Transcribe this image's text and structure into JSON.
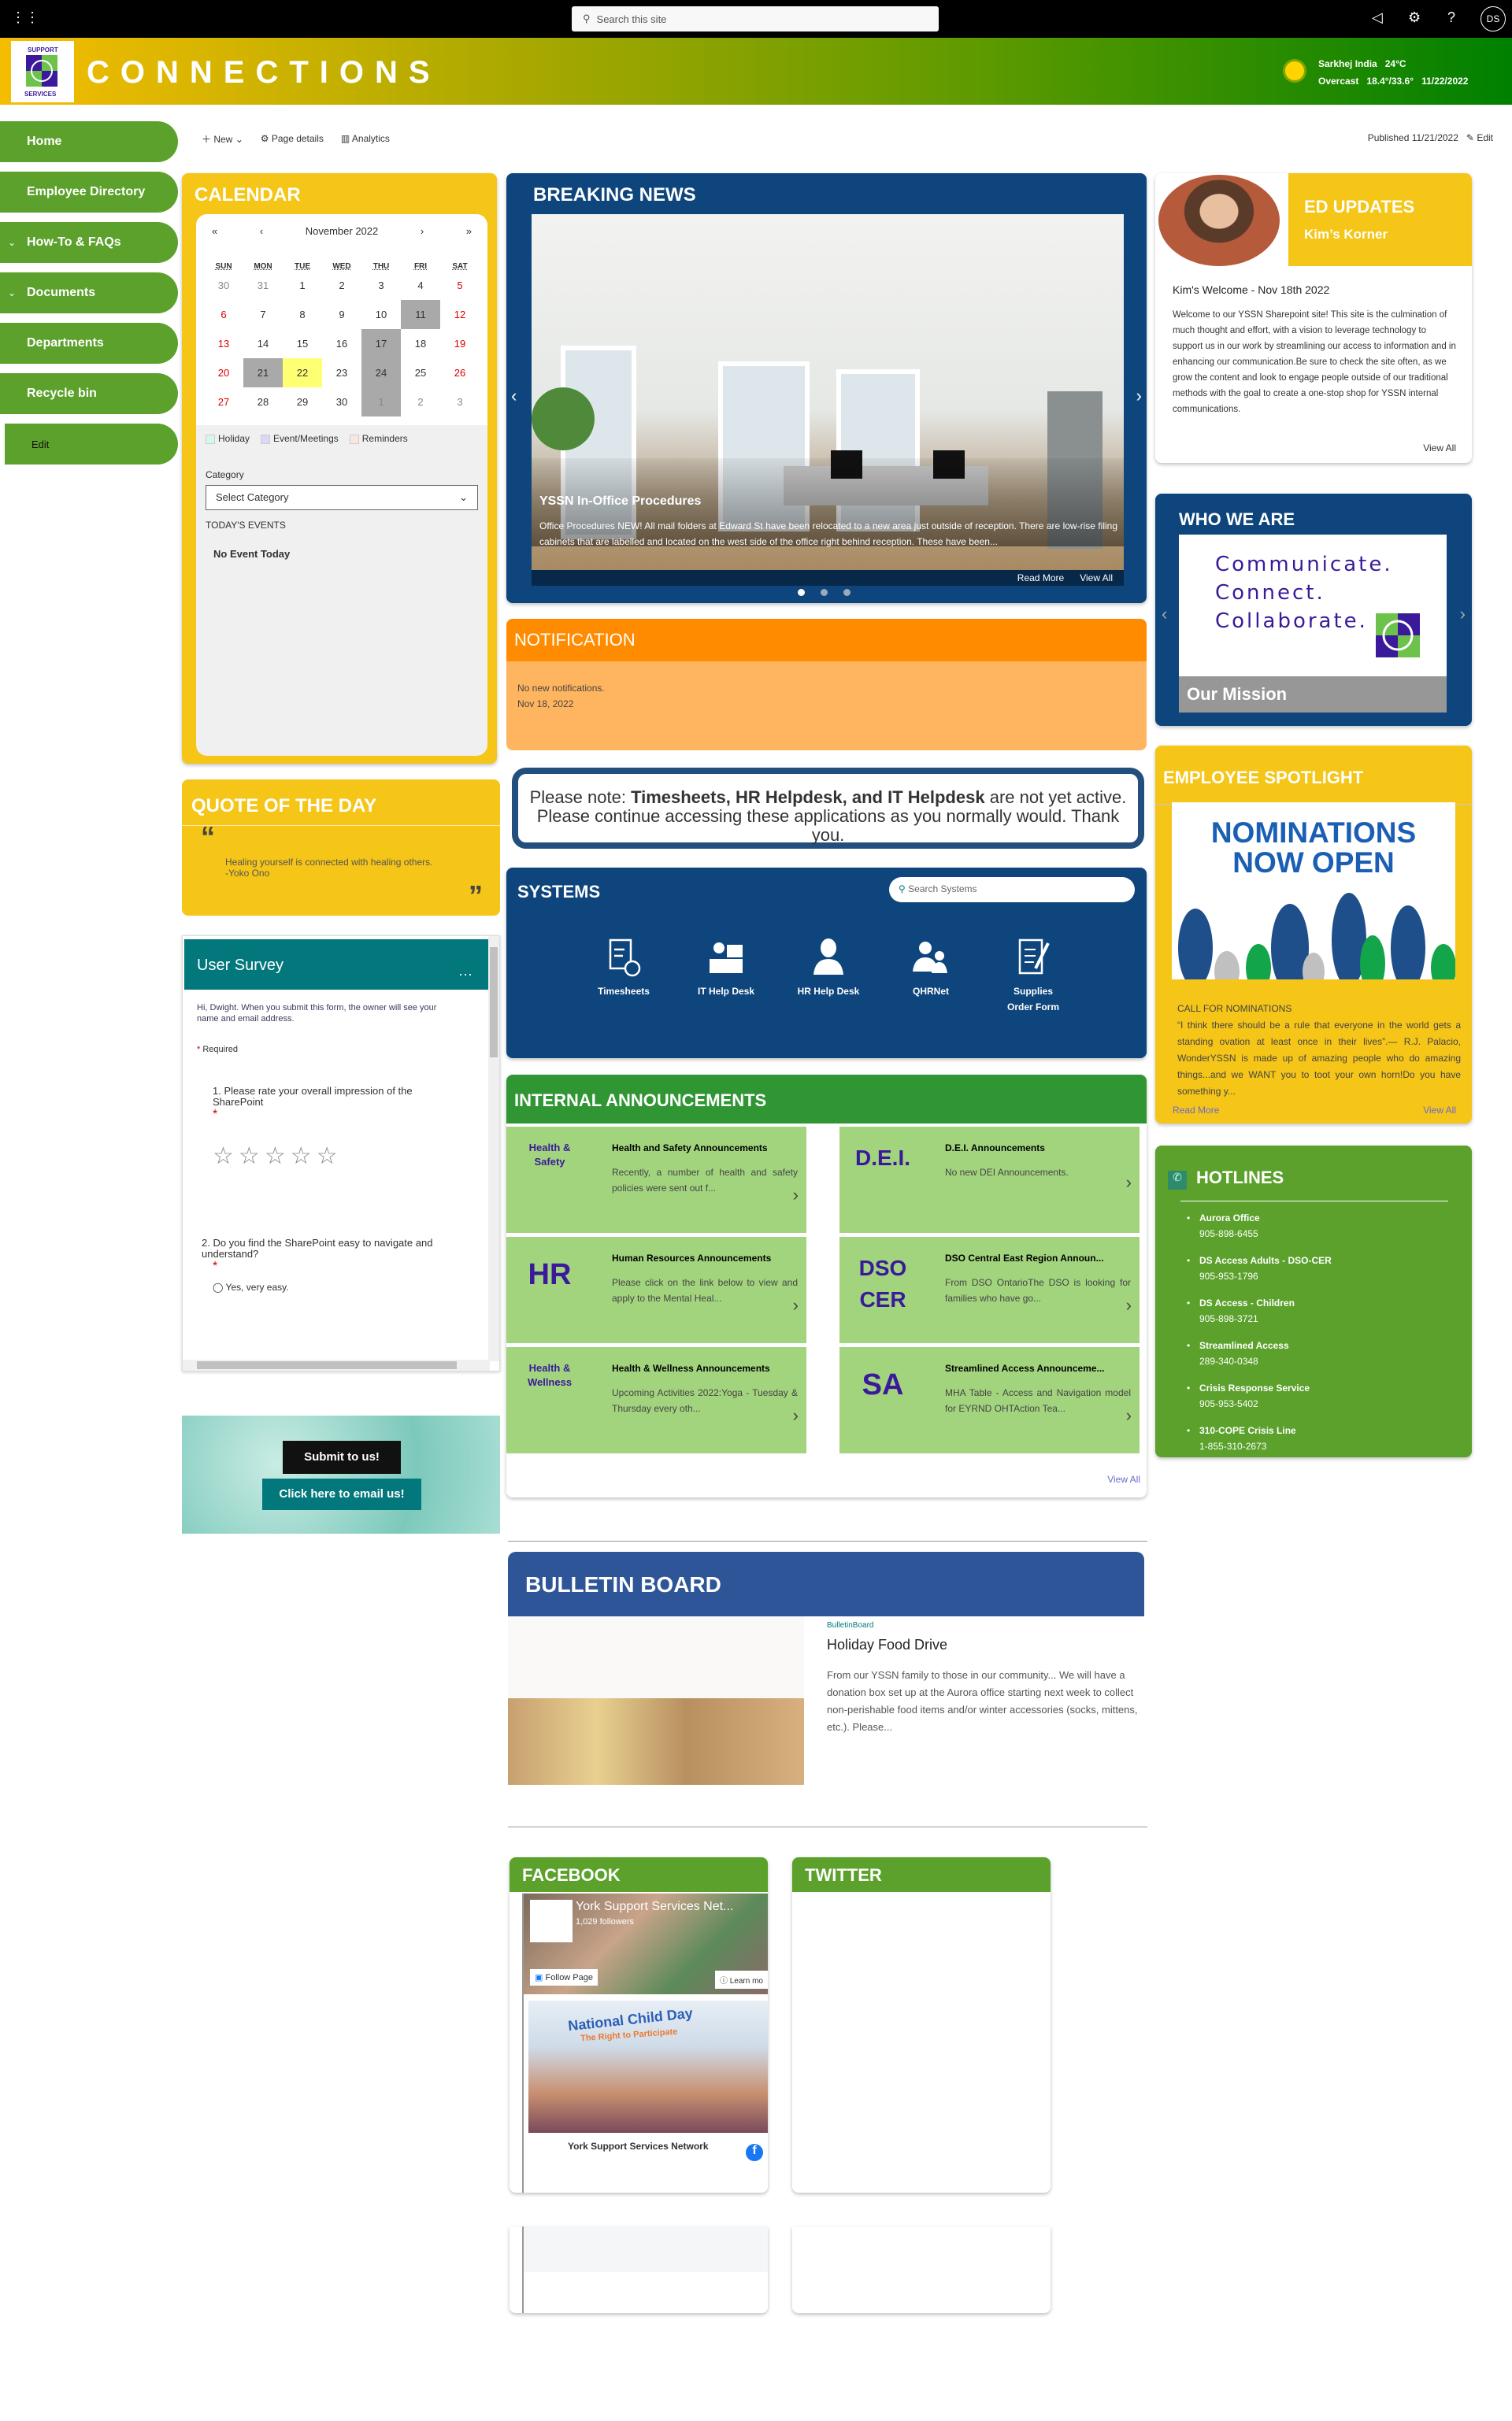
{
  "suite": {
    "search_placeholder": "Search this site",
    "avatar": "DS"
  },
  "site": {
    "title": "CONNECTIONS",
    "weather": {
      "location": "Sarkhej India",
      "temp": "24°C",
      "condition": "Overcast",
      "range": "18.4°/33.6°",
      "date": "11/22/2022",
      "icon": "sun-icon"
    }
  },
  "commands": {
    "new": "New",
    "page_details": "Page details",
    "analytics": "Analytics",
    "published": "Published 11/21/2022",
    "edit": "Edit"
  },
  "nav": [
    {
      "label": "Home"
    },
    {
      "label": "Employee Directory"
    },
    {
      "label": "How-To & FAQs",
      "expand": true
    },
    {
      "label": "Documents",
      "expand": true
    },
    {
      "label": "Departments"
    },
    {
      "label": "Recycle bin"
    },
    {
      "label": "Edit"
    }
  ],
  "calendar": {
    "title": "CALENDAR",
    "month": "November 2022",
    "dow": [
      "SUN",
      "MON",
      "TUE",
      "WED",
      "THU",
      "FRI",
      "SAT"
    ],
    "weeks": [
      [
        {
          "d": "30",
          "muted": true
        },
        {
          "d": "31",
          "muted": true
        },
        {
          "d": "1"
        },
        {
          "d": "2"
        },
        {
          "d": "3"
        },
        {
          "d": "4"
        },
        {
          "d": "5",
          "weekend": true
        }
      ],
      [
        {
          "d": "6",
          "weekend": true
        },
        {
          "d": "7"
        },
        {
          "d": "8"
        },
        {
          "d": "9"
        },
        {
          "d": "10"
        },
        {
          "d": "11",
          "event": true
        },
        {
          "d": "12",
          "weekend": true
        }
      ],
      [
        {
          "d": "13",
          "weekend": true
        },
        {
          "d": "14"
        },
        {
          "d": "15"
        },
        {
          "d": "16"
        },
        {
          "d": "17",
          "event": true
        },
        {
          "d": "18"
        },
        {
          "d": "19",
          "weekend": true
        }
      ],
      [
        {
          "d": "20",
          "weekend": true
        },
        {
          "d": "21",
          "event": true
        },
        {
          "d": "22",
          "today": true
        },
        {
          "d": "23"
        },
        {
          "d": "24",
          "event": true
        },
        {
          "d": "25"
        },
        {
          "d": "26",
          "weekend": true
        }
      ],
      [
        {
          "d": "27",
          "weekend": true
        },
        {
          "d": "28"
        },
        {
          "d": "29"
        },
        {
          "d": "30"
        },
        {
          "d": "1",
          "muted": true,
          "event": true
        },
        {
          "d": "2",
          "muted": true
        },
        {
          "d": "3",
          "muted": true
        }
      ]
    ],
    "legend": [
      {
        "label": "Holiday",
        "color": "#d6f7ee"
      },
      {
        "label": "Event/Meetings",
        "color": "#ddd6f5"
      },
      {
        "label": "Reminders",
        "color": "#fbe6e4"
      }
    ],
    "category_label": "Category",
    "category_value": "Select Category",
    "events_title": "TODAY'S EVENTS",
    "no_event": "No Event Today"
  },
  "quote": {
    "title": "QUOTE OF THE DAY",
    "text": "Healing yourself is connected with healing others.",
    "author": "-Yoko Ono"
  },
  "survey": {
    "title": "User Survey",
    "intro": "Hi, Dwight. When you submit this form, the owner will see your name and email address.",
    "required": "Required",
    "q1": "1. Please rate your overall impression of the SharePoint",
    "rating": 0,
    "q2": "2. Do you find the SharePoint easy to navigate and understand?",
    "q2_option": "Yes, very easy."
  },
  "submit": {
    "submit_label": "Submit to us!",
    "email_label": "Click here to email us!"
  },
  "news": {
    "title": "BREAKING NEWS",
    "headline": "YSSN In-Office Procedures",
    "body": "Office Procedures NEW! All mail folders at Edward St have been relocated to a new area just outside of reception. There are low-rise filing cabinets that are labelled and located on the west side of the office right behind reception. These have been...",
    "read_more": "Read More",
    "view_all": "View All",
    "slides": 3,
    "active_slide": 1
  },
  "notification": {
    "title": "NOTIFICATION",
    "text": "No new notifications.",
    "date": "Nov 18, 2022"
  },
  "note": {
    "prefix": "Please note: ",
    "bold": "Timesheets, HR Helpdesk, and IT Helpdesk",
    "suffix": " are not yet active.",
    "line2": "Please continue accessing these applications as you normally would. Thank you."
  },
  "systems": {
    "title": "SYSTEMS",
    "search_placeholder": "Search Systems",
    "items": [
      {
        "label": "Timesheets",
        "icon": "timesheet-icon"
      },
      {
        "label": "IT Help Desk",
        "icon": "it-help-desk-icon"
      },
      {
        "label": "HR Help Desk",
        "icon": "hr-help-desk-icon"
      },
      {
        "label": "QHRNet",
        "icon": "people-icon"
      },
      {
        "label": "Supplies Order Form",
        "icon": "order-form-icon"
      }
    ]
  },
  "announcements": {
    "title": "INTERNAL ANNOUNCEMENTS",
    "view_all": "View All",
    "items": [
      {
        "logo": "Health & Safety",
        "title": "Health and Safety Announcements",
        "desc": "Recently, a number of health and safety policies were sent out f..."
      },
      {
        "logo": "D.E.I.",
        "title": "D.E.I. Announcements",
        "desc": "No new DEI Announcements."
      },
      {
        "logo": "HR",
        "title": "Human Resources Announcements",
        "desc": "Please click on the link below to view and apply to the Mental Heal..."
      },
      {
        "logo": "DSO CER",
        "title": "DSO Central East Region Announ...",
        "desc": "From DSO OntarioThe DSO is looking for families who have go..."
      },
      {
        "logo": "Health & Wellness",
        "title": "Health & Wellness Announcements",
        "desc": "Upcoming Activities 2022:Yoga - Tuesday & Thursday every oth..."
      },
      {
        "logo": "SA",
        "title": "Streamlined Access Announceme...",
        "desc": "MHA Table - Access and Navigation model for EYRND OHTAction Tea..."
      }
    ]
  },
  "ed": {
    "title": "ED UPDATES",
    "subtitle": "Kim’s Korner",
    "post_title": "Kim's Welcome - Nov 18th 2022",
    "body": "Welcome to our YSSN Sharepoint site! This site is the culmination of much thought and effort, with a vision to leverage technology to support us in our work by streamlining our access to information and in enhancing our communication.Be sure to check the site often, as we grow the content and look to engage people outside of our traditional methods with the goal to create a one-stop shop for YSSN internal communications.",
    "view_all": "View All"
  },
  "who": {
    "title": "WHO WE ARE",
    "lines": [
      "Communicate.",
      "Connect.",
      "Collaborate."
    ],
    "caption": "Our Mission"
  },
  "spotlight": {
    "title": "EMPLOYEE SPOTLIGHT",
    "banner": "NOMINATIONS NOW OPEN",
    "heading": "CALL FOR NOMINATIONS",
    "body": "“I think there should be a rule that everyone in the world gets a standing ovation at least once in their lives”.— R.J. Palacio, WonderYSSN is made up of amazing people who do amazing things...and we WANT you to toot your own horn!Do you have something y...",
    "read_more": "Read More",
    "view_all": "View All"
  },
  "hotlines": {
    "title": "HOTLINES",
    "items": [
      {
        "name": "Aurora Office",
        "phone": "905-898-6455"
      },
      {
        "name": "DS Access Adults - DSO-CER",
        "phone": "905-953-1796"
      },
      {
        "name": "DS Access - Children",
        "phone": "905-898-3721"
      },
      {
        "name": "Streamlined Access",
        "phone": "289-340-0348"
      },
      {
        "name": "Crisis Response Service",
        "phone": "905-953-5402"
      },
      {
        "name": "310-COPE Crisis Line",
        "phone": "1-855-310-2673"
      }
    ]
  },
  "bulletin": {
    "title": "BULLETIN BOARD",
    "category": "BulletinBoard",
    "post_title": "Holiday Food Drive",
    "body": "From our YSSN family to those in our community... We will have a donation box set up at the Aurora office starting next week to collect non-perishable food items and/or winter accessories (socks, mittens, etc.). Please..."
  },
  "facebook": {
    "title": "FACEBOOK",
    "page_name": "York Support Services Net...",
    "followers": "1,029 followers",
    "follow": "Follow Page",
    "learn": "Learn mo",
    "post_image_text": "National Child Day",
    "post_image_sub": "The Right to Participate",
    "post_author": "York Support Services Network"
  },
  "twitter": {
    "title": "TWITTER"
  },
  "colors": {
    "green": "#5ba12b",
    "yellow": "#f5c518",
    "navy": "#0e457c",
    "orange": "#ff8c00",
    "teal": "#03787c"
  }
}
